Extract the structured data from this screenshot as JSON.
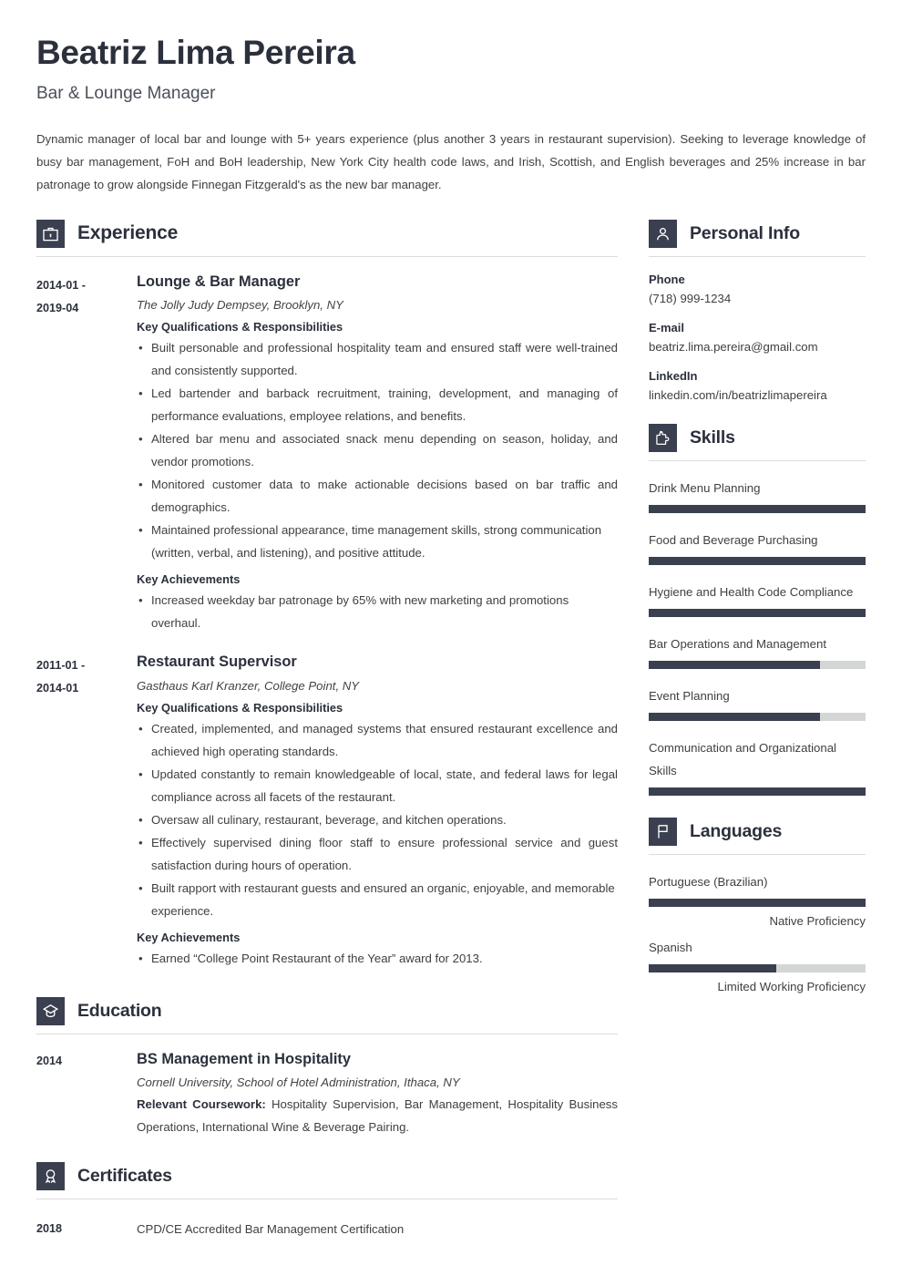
{
  "header": {
    "name": "Beatriz Lima Pereira",
    "job_title": "Bar & Lounge Manager",
    "summary": "Dynamic manager of local bar and lounge with 5+ years experience (plus another 3 years in restaurant supervision). Seeking to leverage knowledge of busy bar management, FoH and BoH leadership, New York City health code laws, and Irish, Scottish, and English beverages and 25% increase in bar patronage to grow alongside Finnegan Fitzgerald's as the new bar manager."
  },
  "theme": {
    "accent_dark": "#3a4050",
    "heading_color": "#2b303c",
    "bar_track": "#d4d6d6",
    "rule_color": "#dcdcdc"
  },
  "experience": {
    "title": "Experience",
    "icon": "briefcase-icon",
    "entries": [
      {
        "date_start": "2014-01 -",
        "date_end": "2019-04",
        "role": "Lounge & Bar Manager",
        "org": "The Jolly Judy Dempsey, Brooklyn, NY",
        "qualifications_heading": "Key Qualifications & Responsibilities",
        "qualifications": [
          "Built personable and professional hospitality team and ensured staff were well-trained and consistently supported.",
          "Led bartender and barback recruitment, training, development, and managing of performance evaluations, employee relations, and benefits.",
          "Altered bar menu and associated snack menu depending on season, holiday, and vendor promotions.",
          "Monitored customer data to make actionable decisions based on bar traffic and demographics.",
          "Maintained professional appearance, time management skills, strong communication (written, verbal, and listening), and positive attitude."
        ],
        "achievements_heading": "Key Achievements",
        "achievements": [
          "Increased weekday bar patronage by 65% with new marketing and promotions overhaul."
        ]
      },
      {
        "date_start": "2011-01 -",
        "date_end": "2014-01",
        "role": "Restaurant Supervisor",
        "org": "Gasthaus Karl Kranzer, College Point, NY",
        "qualifications_heading": "Key Qualifications & Responsibilities",
        "qualifications": [
          "Created, implemented, and managed systems that ensured restaurant excellence and achieved high operating standards.",
          "Updated constantly to remain knowledgeable of local, state, and federal laws for legal compliance across all facets of the restaurant.",
          "Oversaw all culinary, restaurant, beverage, and kitchen operations.",
          "Effectively supervised dining floor staff to ensure professional service and guest satisfaction during hours of operation.",
          "Built rapport with restaurant guests and ensured an organic, enjoyable, and memorable experience."
        ],
        "achievements_heading": "Key Achievements",
        "achievements": [
          "Earned “College Point Restaurant of the Year” award for 2013."
        ]
      }
    ]
  },
  "education": {
    "title": "Education",
    "icon": "graduation-cap-icon",
    "entries": [
      {
        "date": "2014",
        "degree": "BS Management in Hospitality",
        "school": "Cornell University, School of Hotel Administration, Ithaca, NY",
        "coursework_label": "Relevant Coursework:",
        "coursework": "Hospitality Supervision, Bar Management, Hospitality Business Operations, International Wine & Beverage Pairing."
      }
    ]
  },
  "certificates": {
    "title": "Certificates",
    "icon": "award-ribbon-icon",
    "entries": [
      {
        "date": "2018",
        "name": "CPD/CE Accredited Bar Management Certification"
      }
    ]
  },
  "personal_info": {
    "title": "Personal Info",
    "icon": "person-icon",
    "fields": [
      {
        "label": "Phone",
        "value": "(718) 999-1234"
      },
      {
        "label": "E-mail",
        "value": "beatriz.lima.pereira@gmail.com"
      },
      {
        "label": "LinkedIn",
        "value": "linkedin.com/in/beatrizlimapereira"
      }
    ]
  },
  "skills": {
    "title": "Skills",
    "icon": "puzzle-piece-icon",
    "items": [
      {
        "name": "Drink Menu Planning",
        "level": 100
      },
      {
        "name": "Food and Beverage Purchasing",
        "level": 100
      },
      {
        "name": "Hygiene and Health Code Compliance",
        "level": 100
      },
      {
        "name": "Bar Operations and Management",
        "level": 79
      },
      {
        "name": "Event Planning",
        "level": 79
      },
      {
        "name": "Communication and Organizational Skills",
        "level": 100
      }
    ]
  },
  "languages": {
    "title": "Languages",
    "icon": "flag-icon",
    "items": [
      {
        "name": "Portuguese (Brazilian)",
        "level": 100,
        "proficiency": "Native Proficiency"
      },
      {
        "name": "Spanish",
        "level": 59,
        "proficiency": "Limited Working Proficiency"
      }
    ]
  }
}
